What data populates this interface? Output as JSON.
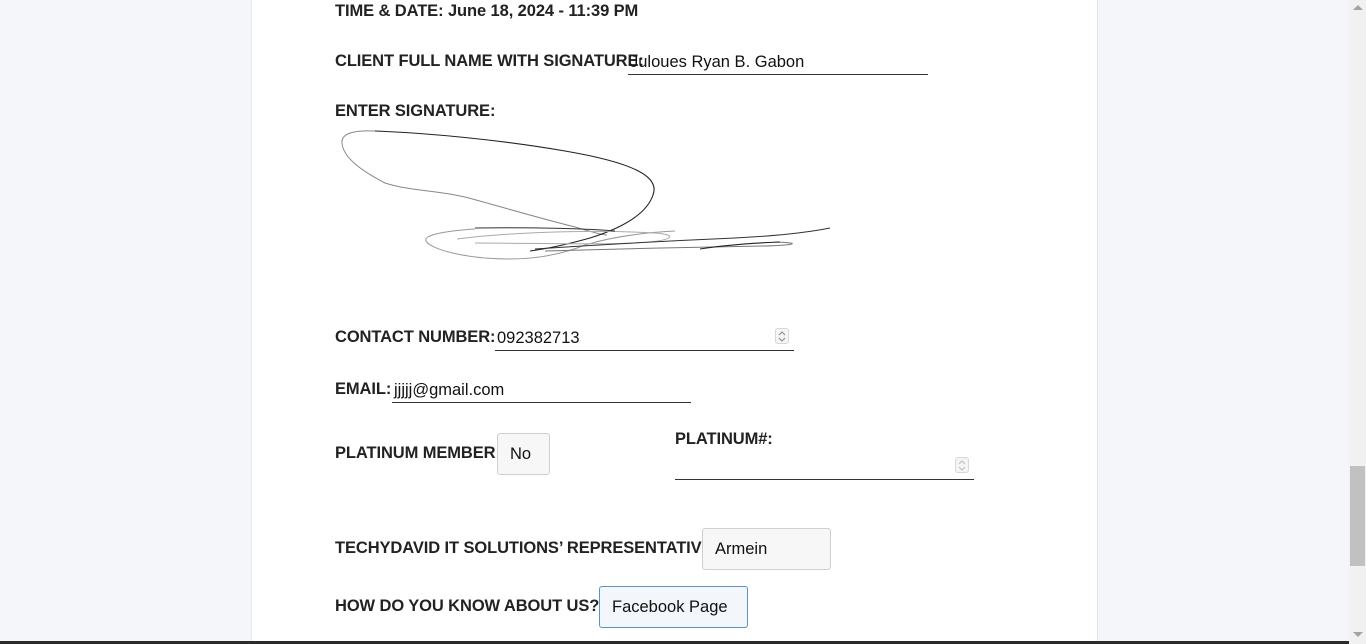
{
  "form": {
    "time_date": "TIME & DATE: June 18, 2024 - 11:39 PM",
    "client_name_label": "CLIENT FULL NAME WITH SIGNATURE:",
    "client_name_value": "Juloues Ryan B. Gabon",
    "signature_label": "ENTER SIGNATURE:",
    "contact_label": "CONTACT NUMBER:",
    "contact_value": "092382713",
    "email_label": "EMAIL:",
    "email_value": "jjjjj@gmail.com",
    "platinum_member_label": "PLATINUM MEMBER:",
    "platinum_member_value": "No",
    "platinum_number_label": "PLATINUM#:",
    "platinum_number_value": "",
    "representative_label": "TECHYDAVID IT SOLUTIONS’ REPRESENTATIVE:",
    "representative_value": "Armein",
    "referral_label": "HOW DO YOU KNOW ABOUT US?:",
    "referral_value": "Facebook Page"
  },
  "icons": {
    "spinner": "spinner-arrows-icon"
  },
  "colors": {
    "page_bg": "#f4f6f9",
    "card_bg": "#ffffff",
    "text": "#222222",
    "focus_border": "#5b93c7"
  }
}
